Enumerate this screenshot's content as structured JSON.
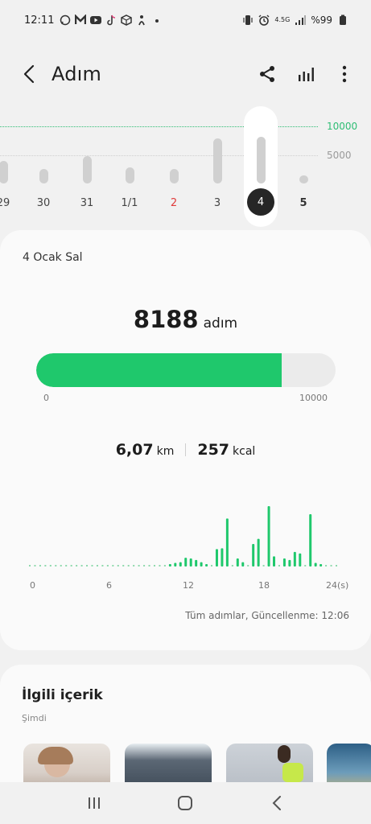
{
  "status": {
    "time": "12:11",
    "network": "4.5G",
    "battery": "%99",
    "icons": [
      "whatsapp-icon",
      "gmail-icon",
      "youtube-icon",
      "tiktok-icon",
      "cube-icon",
      "figure-icon",
      "dot-icon",
      "vibrate-icon",
      "alarm-icon",
      "signal-icon",
      "battery-icon"
    ]
  },
  "header": {
    "title": "Adım",
    "icons": [
      "back-icon",
      "share-icon",
      "bar-chart-icon",
      "more-icon"
    ]
  },
  "daily_chart": {
    "goal_label": "10000",
    "mid_label": "5000",
    "days": [
      {
        "label": "29",
        "steps": 4000
      },
      {
        "label": "30",
        "steps": 2500
      },
      {
        "label": "31",
        "steps": 4800
      },
      {
        "label": "1/1",
        "steps": 2800
      },
      {
        "label": "2",
        "steps": 2600,
        "holiday": true
      },
      {
        "label": "3",
        "steps": 7900
      },
      {
        "label": "4",
        "steps": 8188,
        "selected": true
      },
      {
        "label": "5",
        "steps": 900,
        "next": true
      }
    ],
    "max": 10000
  },
  "card": {
    "date": "4 Ocak Sal",
    "steps": "8188",
    "steps_unit": "adım",
    "progress_value": 8188,
    "progress_goal": 10000,
    "progress_min_label": "0",
    "progress_max_label": "10000",
    "distance": "6,07",
    "distance_unit": "km",
    "calories": "257",
    "calories_unit": "kcal",
    "hour_ticks": [
      "0",
      "6",
      "12",
      "18",
      "24(s)"
    ],
    "hourly_values": [
      0,
      0,
      0,
      0,
      0,
      0,
      0,
      0,
      0,
      0,
      0,
      0,
      0,
      0,
      0,
      0,
      0,
      0,
      0,
      0,
      0,
      0,
      0,
      0,
      0,
      0,
      0,
      3,
      5,
      6,
      12,
      11,
      9,
      6,
      3,
      0,
      24,
      25,
      66,
      0,
      11,
      6,
      0,
      31,
      38,
      0,
      83,
      14,
      0,
      11,
      9,
      20,
      18,
      0,
      72,
      5,
      3,
      0,
      0,
      0
    ],
    "updated": "Tüm adımlar, Güncellenme: 12:06"
  },
  "related": {
    "title": "İlgili içerik",
    "subtitle": "Şimdi",
    "thumbnails": [
      "woman-exercise-thumb",
      "couch-thumb",
      "runner-thumb",
      "outdoor-thumb"
    ]
  },
  "nav": [
    "recents-icon",
    "home-icon",
    "back-nav-icon"
  ],
  "colors": {
    "accent": "#1fc86c",
    "goal_line": "#2ebd74",
    "holiday": "#e03b3b",
    "bar_inactive": "#d0d0d0"
  }
}
